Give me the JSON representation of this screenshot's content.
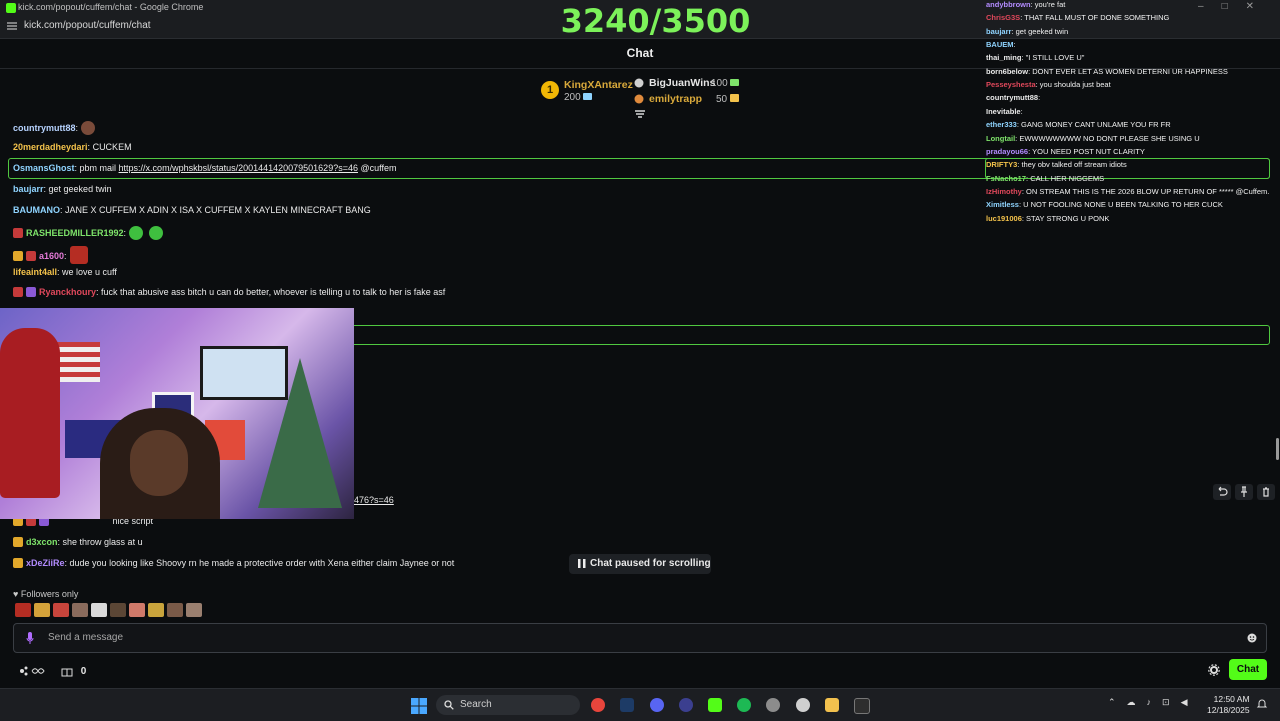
{
  "browser": {
    "window_title": "kick.com/popout/cuffem/chat - Google Chrome",
    "url": "kick.com/popout/cuffem/chat"
  },
  "goal": {
    "text": "3240/3500"
  },
  "panel_title": "Chat",
  "leaderboard": [
    {
      "rank": "1",
      "name": "KingXAntarez",
      "count": "200",
      "color": "#d9a93b"
    },
    {
      "name": "BigJuanWins",
      "count": "100",
      "color": "#e6e6e6"
    },
    {
      "name": "emilytrapp",
      "count": "50",
      "color": "#d9a93b"
    }
  ],
  "chat": [
    {
      "user": "countrymutt88",
      "sep": ":",
      "text": "",
      "color": "#b7d3ff",
      "badges": [],
      "emote": "bear"
    },
    {
      "user": "20merdadheydari",
      "sep": ":",
      "text": " CUCKEM",
      "color": "#f3c24b",
      "badges": []
    },
    {
      "user": "OsmansGhost",
      "sep": ":",
      "text": " pbm mail ",
      "link": "https://x.com/wphskbsl/status/2001441420079501629?s=46",
      "tail": " @cuffem",
      "color": "#8fd4ff",
      "badges": []
    },
    {
      "user": "baujarr",
      "sep": ":",
      "text": " get geeked twin",
      "color": "#8fd4ff",
      "badges": []
    },
    {
      "user": "BAUMANO",
      "sep": ":",
      "text": " JANE X CUFFEM X ADIN X ISA X CUFFEM X KAYLEN MINECRAFT BANG",
      "color": "#8fd4ff",
      "badges": []
    },
    {
      "user": "RASHEEDMILLER1992",
      "sep": ":",
      "text": "",
      "color": "#7ee36a",
      "badges": [
        "red"
      ],
      "emote": "green2"
    },
    {
      "user": "a1600",
      "sep": ":",
      "text": "",
      "color": "#e67bd8",
      "badges": [
        "gold",
        "red"
      ],
      "emote": "red"
    },
    {
      "user": "lifeaint4all",
      "sep": ":",
      "text": " we love u cuff",
      "color": "#f3c24b",
      "badges": []
    },
    {
      "user": "Ryanckhoury",
      "sep": ":",
      "text": " fuck that abusive ass bitch u can do better, whoever is telling u to talk to her is fake asf",
      "color": "#e0485b",
      "badges": [
        "red",
        "purple"
      ]
    },
    {
      "user": "",
      "sep": "",
      "text": "",
      "partial_link": "476?s=46",
      "color": "#eaeaea",
      "badges": []
    },
    {
      "user": "",
      "sep": "",
      "text": " nice script",
      "color": "#e0485b",
      "badges": [
        "gold",
        "purple"
      ]
    },
    {
      "user": "d3xcon",
      "sep": ":",
      "text": " she throw glass at u",
      "color": "#7ee36a",
      "badges": [
        "gold"
      ]
    },
    {
      "user": "xDeZiiRe",
      "sep": ":",
      "text": " dude you looking like Shoovy rn he made a protective order with Xena either claim Jaynee or not",
      "color": "#b38cff",
      "badges": [
        "gold"
      ]
    }
  ],
  "overlay_chat": [
    {
      "user": "andybbrown",
      "text": "you're fat",
      "color": "#b38cff"
    },
    {
      "user": "ChrisG3S",
      "text": "THAT FALL MUST OF DONE SOMETHING",
      "color": "#e0485b"
    },
    {
      "user": "baujarr",
      "text": "get geeked twin",
      "color": "#8fd4ff"
    },
    {
      "user": "BAUEM",
      "text": "",
      "color": "#8fd4ff"
    },
    {
      "user": "thai_ming",
      "text": "\"I STILL LOVE U\"",
      "color": "#eaeaea"
    },
    {
      "user": "born6below",
      "text": "DONT EVER LET AS WOMEN DETERNI UR HAPPINESS",
      "color": "#eaeaea"
    },
    {
      "user": "Pesseyshesta",
      "text": "you shoulda just beat",
      "color": "#e0485b"
    },
    {
      "user": "countrymutt88",
      "text": "",
      "color": "#eaeaea"
    },
    {
      "user": "Inevitable",
      "text": "",
      "color": "#eaeaea"
    },
    {
      "user": "ether333",
      "text": "GANG MONEY CANT UNLAME YOU FR FR",
      "color": "#8fd4ff"
    },
    {
      "user": "Longtail",
      "text": "EWWWWWWWW NO DONT PLEASE SHE USING U",
      "color": "#7ee36a"
    },
    {
      "user": "pradayou66",
      "text": "YOU NEED POST NUT CLARITY",
      "color": "#b38cff"
    },
    {
      "user": "DRIFTY3",
      "text": "they obv talked off stream idiots",
      "color": "#f3c24b"
    },
    {
      "user": "FsNacho17",
      "text": "CALL HER NIGGEMS",
      "color": "#7ee36a"
    },
    {
      "user": "IzHimothy",
      "text": "ON STREAM THIS IS THE 2026 BLOW UP RETURN OF ***** @Cuffem.",
      "color": "#e0485b"
    },
    {
      "user": "Ximitless",
      "text": "U NOT FOOLING NONE U BEEN TALKING TO HER CUCK",
      "color": "#8fd4ff"
    },
    {
      "user": "luc191006",
      "text": "STAY STRONG U PONK",
      "color": "#f3c24b"
    }
  ],
  "status": {
    "paused": "Chat paused for scrolling",
    "followers_only": "Followers only"
  },
  "input": {
    "placeholder": "Send a message"
  },
  "footer": {
    "gift_count": "0",
    "chat_button": "Chat"
  },
  "taskbar": {
    "search_placeholder": "Search",
    "time": "12:50 AM",
    "date": "12/18/2025"
  },
  "colors": {
    "accent": "#53fc18",
    "highlight_border": "#50c840"
  }
}
